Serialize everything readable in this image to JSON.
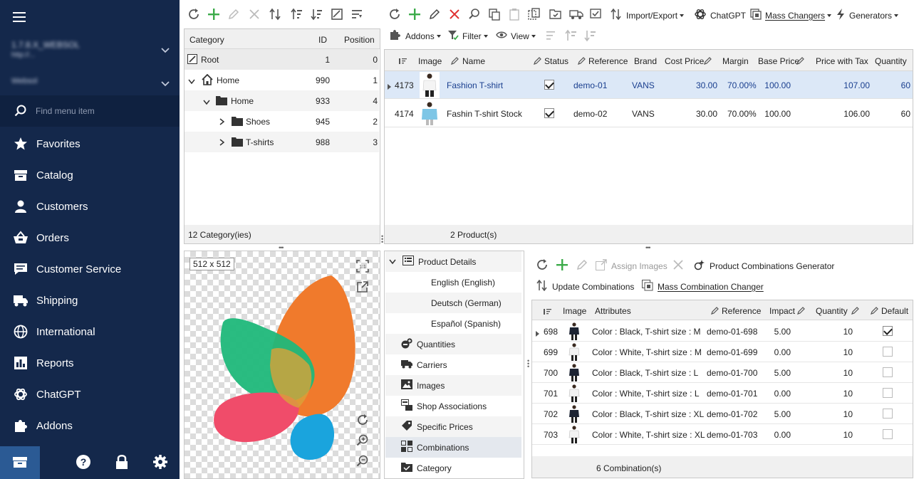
{
  "sidebar": {
    "store_name": "1.7.8.X_WEBSOL",
    "store_url": "http://...",
    "shop_select": "Websol",
    "search_placeholder": "Find menu item",
    "items": [
      {
        "label": "Favorites",
        "icon": "star-icon"
      },
      {
        "label": "Catalog",
        "icon": "catalog-icon"
      },
      {
        "label": "Customers",
        "icon": "user-icon"
      },
      {
        "label": "Orders",
        "icon": "basket-icon"
      },
      {
        "label": "Customer Service",
        "icon": "chat-icon"
      },
      {
        "label": "Shipping",
        "icon": "truck-icon"
      },
      {
        "label": "International",
        "icon": "globe-icon"
      },
      {
        "label": "Reports",
        "icon": "reports-icon"
      },
      {
        "label": "ChatGPT",
        "icon": "chatgpt-icon"
      },
      {
        "label": "Addons",
        "icon": "puzzle-icon"
      }
    ]
  },
  "categories": {
    "headers": {
      "category": "Category",
      "id": "ID",
      "position": "Position"
    },
    "rows": [
      {
        "name": "Root",
        "id": "1",
        "position": "0"
      },
      {
        "name": "Home",
        "id": "990",
        "position": "1"
      },
      {
        "name": "Home",
        "id": "933",
        "position": "4"
      },
      {
        "name": "Shoes",
        "id": "945",
        "position": "2"
      },
      {
        "name": "T-shirts",
        "id": "988",
        "position": "3"
      }
    ],
    "footer": "12 Category(ies)"
  },
  "products_toolbar": {
    "import_export": "Import/Export",
    "chatgpt": "ChatGPT",
    "mass_changers": "Mass Changers",
    "generators": "Generators",
    "addons": "Addons",
    "filter": "Filter",
    "view": "View"
  },
  "products": {
    "headers": {
      "image": "Image",
      "name": "Name",
      "status": "Status",
      "reference": "Reference",
      "brand": "Brand",
      "cost_price": "Cost Price",
      "margin": "Margin",
      "base_price": "Base Price",
      "price_with_tax": "Price with Tax",
      "quantity": "Quantity"
    },
    "rows": [
      {
        "id": "4173",
        "name": "Fashion T-shirt",
        "reference": "demo-01",
        "brand": "VANS",
        "cost_price": "30.00",
        "margin": "70.00%",
        "base_price": "100.00",
        "price_with_tax": "107.00",
        "quantity": "60"
      },
      {
        "id": "4174",
        "name": "Fashin T-shirt Stock",
        "reference": "demo-02",
        "brand": "VANS",
        "cost_price": "30.00",
        "margin": "70.00%",
        "base_price": "100.00",
        "price_with_tax": "106.00",
        "quantity": "60"
      }
    ],
    "footer": "2 Product(s)"
  },
  "image_preview": {
    "size_label": "512 x 512"
  },
  "details": {
    "items": [
      {
        "label": "Product Details"
      },
      {
        "label": "English (English)"
      },
      {
        "label": "Deutsch (German)"
      },
      {
        "label": "Español (Spanish)"
      },
      {
        "label": "Quantities"
      },
      {
        "label": "Carriers"
      },
      {
        "label": "Images"
      },
      {
        "label": "Shop Associations"
      },
      {
        "label": "Specific Prices"
      },
      {
        "label": "Combinations"
      },
      {
        "label": "Category"
      }
    ]
  },
  "combinations_toolbar": {
    "assign_images": "Assign Images",
    "generator": "Product Combinations Generator",
    "update": "Update Combinations",
    "mass_changer": "Mass Combination Changer"
  },
  "combinations": {
    "headers": {
      "image": "Image",
      "attributes": "Attributes",
      "reference": "Reference",
      "impact": "Impact",
      "quantity": "Quantity",
      "default": "Default"
    },
    "rows": [
      {
        "id": "698",
        "attributes": "Color : Black, T-shirt size : M",
        "reference": "demo-01-698",
        "impact": "5.00",
        "quantity": "10"
      },
      {
        "id": "699",
        "attributes": "Color : White, T-shirt size : M",
        "reference": "demo-01-699",
        "impact": "0.00",
        "quantity": "10"
      },
      {
        "id": "700",
        "attributes": "Color : Black, T-shirt size : L",
        "reference": "demo-01-700",
        "impact": "5.00",
        "quantity": "10"
      },
      {
        "id": "701",
        "attributes": "Color : White, T-shirt size : L",
        "reference": "demo-01-701",
        "impact": "0.00",
        "quantity": "10"
      },
      {
        "id": "702",
        "attributes": "Color : Black, T-shirt size : XL",
        "reference": "demo-01-702",
        "impact": "5.00",
        "quantity": "10"
      },
      {
        "id": "703",
        "attributes": "Color : White, T-shirt size : XL",
        "reference": "demo-01-703",
        "impact": "0.00",
        "quantity": "10"
      }
    ],
    "footer": "6 Combination(s)"
  },
  "colors": {
    "sidebar": "#14284b",
    "accent_green": "#3cab4a",
    "accent_red": "#e03030",
    "selected_row": "#dce8f7"
  }
}
